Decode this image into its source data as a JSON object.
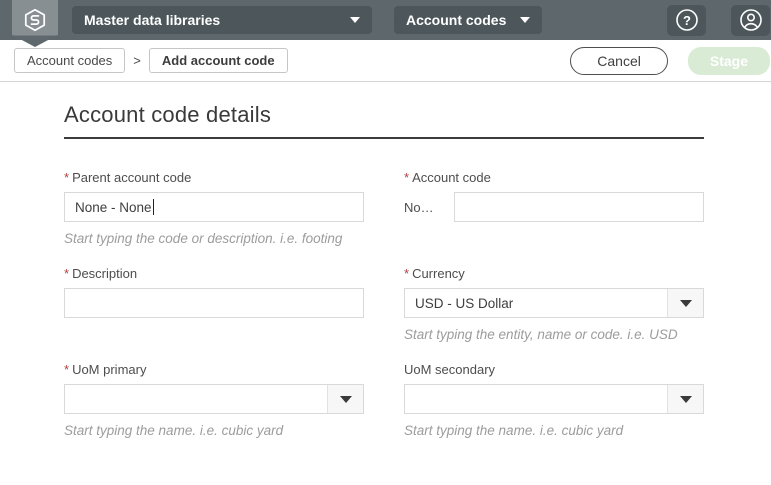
{
  "colors": {
    "header_bg": "#5e686c",
    "header_control_bg": "#4d575b",
    "logo_badge_bg": "#878f93",
    "stage_disabled_bg": "#d9ead5",
    "stage_disabled_text": "#ffffff",
    "required_asterisk": "#a94442",
    "helper_text": "#9c9c9c"
  },
  "header": {
    "library_selector": {
      "label": "Master data libraries"
    },
    "module_selector": {
      "label": "Account codes"
    }
  },
  "toolbar": {
    "breadcrumbs": [
      {
        "label": "Account codes"
      },
      {
        "label": "Add account code"
      }
    ],
    "separator": ">",
    "cancel_label": "Cancel",
    "stage_label": "Stage"
  },
  "form": {
    "title": "Account code details",
    "required_marker": "*",
    "fields": {
      "parent_account_code": {
        "label": "Parent account code",
        "required": true,
        "value": "None - None",
        "helper": "Start typing the code or description. i.e. footing"
      },
      "account_code": {
        "label": "Account code",
        "required": true,
        "prefix": "No…",
        "value": ""
      },
      "description": {
        "label": "Description",
        "required": true,
        "value": ""
      },
      "currency": {
        "label": "Currency",
        "required": true,
        "value": "USD - US Dollar",
        "helper": "Start typing the entity, name or code. i.e. USD"
      },
      "uom_primary": {
        "label": "UoM primary",
        "required": true,
        "value": "",
        "helper": "Start typing the name. i.e. cubic yard"
      },
      "uom_secondary": {
        "label": "UoM secondary",
        "required": false,
        "value": "",
        "helper": "Start typing the name. i.e. cubic yard"
      }
    }
  }
}
